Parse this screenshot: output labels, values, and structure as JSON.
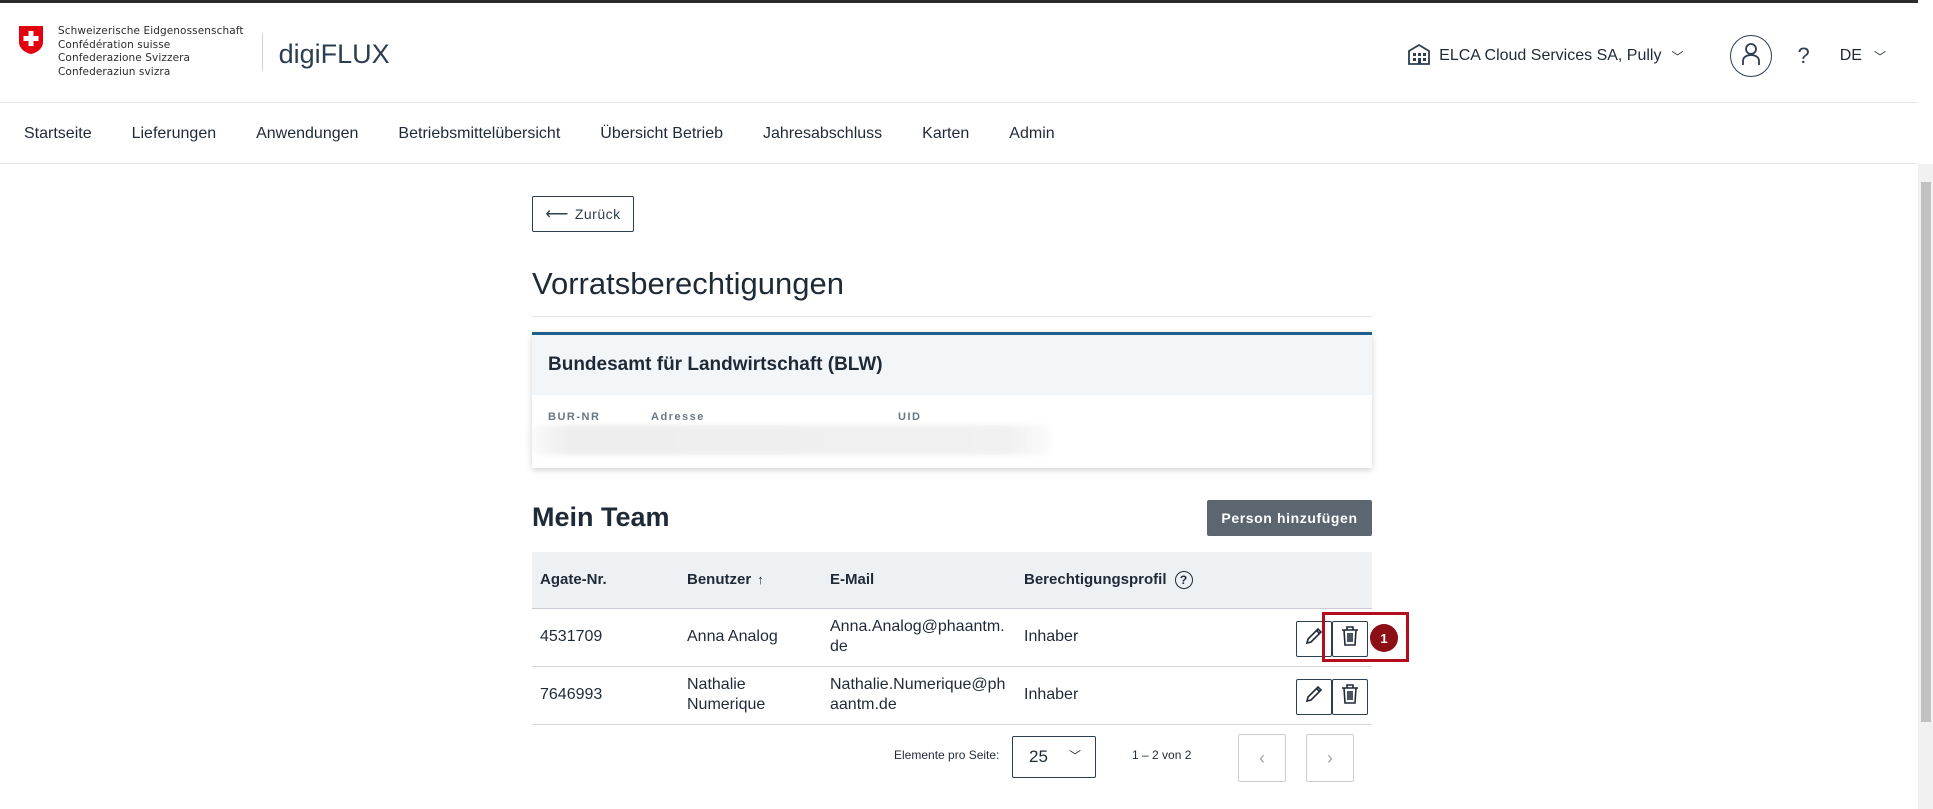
{
  "header": {
    "confederation_lines": [
      "Schweizerische Eidgenossenschaft",
      "Confédération suisse",
      "Confederazione Svizzera",
      "Confederaziun svizra"
    ],
    "app_name": "digiFLUX",
    "organization": "ELCA Cloud Services SA, Pully",
    "help_label": "?",
    "language": "DE"
  },
  "nav": {
    "items": [
      "Startseite",
      "Lieferungen",
      "Anwendungen",
      "Betriebsmittelübersicht",
      "Übersicht Betrieb",
      "Jahresabschluss",
      "Karten",
      "Admin"
    ]
  },
  "main": {
    "back_label": "Zurück",
    "page_title": "Vorratsberechtigungen",
    "card": {
      "title": "Bundesamt für Landwirtschaft (BLW)",
      "columns": [
        "BUR-NR",
        "Adresse",
        "UID"
      ]
    },
    "team_title": "Mein Team",
    "add_person_label": "Person hinzufügen",
    "table": {
      "headers": [
        "Agate-Nr.",
        "Benutzer",
        "E-Mail",
        "Berechtigungsprofil"
      ],
      "sort_indicator": "↑",
      "info_icon": "?",
      "rows": [
        {
          "agate": "4531709",
          "user": "Anna Analog",
          "email": "Anna.Analog@phaantm.de",
          "profile": "Inhaber"
        },
        {
          "agate": "7646993",
          "user": "Nathalie Numerique",
          "email": "Nathalie.Numerique@phaantm.de",
          "profile": "Inhaber"
        }
      ]
    },
    "annotation_badge": "1",
    "pager": {
      "items_per_page_label": "Elemente pro Seite:",
      "items_per_page": "25",
      "range_label": "1 – 2 von 2",
      "prev": "‹",
      "next": "›"
    }
  },
  "colors": {
    "accent": "#1f5f8f",
    "button_dark": "#5b6670",
    "highlight": "#b30d1e",
    "badge": "#8b0f14"
  }
}
